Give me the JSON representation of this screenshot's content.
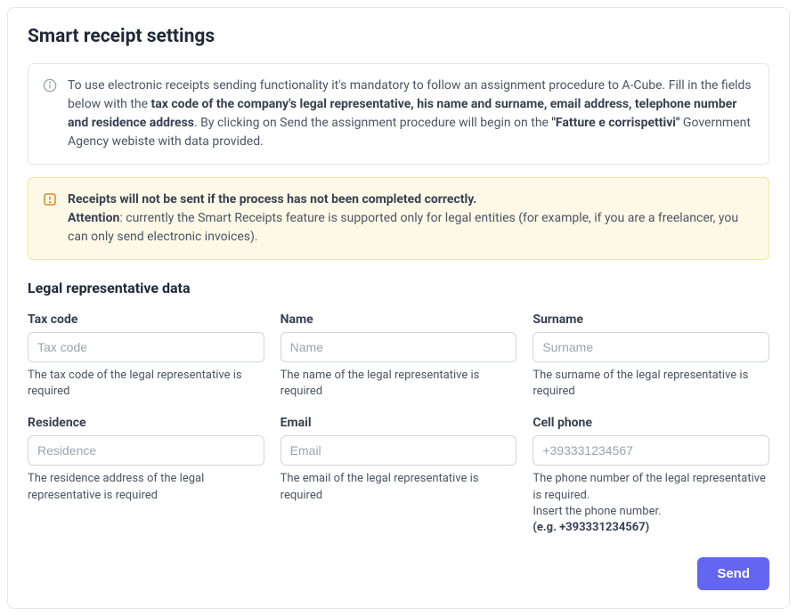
{
  "title": "Smart receipt settings",
  "info_banner": {
    "p1a": "To use electronic receipts sending functionality it's mandatory to follow an assignment procedure to A-Cube. Fill in the fields below with the ",
    "p1b": "tax code of the company's legal representative, his name and surname, email address, telephone number and residence address",
    "p1c": ". By clicking on Send the assignment procedure will begin on the ",
    "p1d": "\"Fatture e corrispettivi\"",
    "p1e": " Government Agency webiste with data provided."
  },
  "warn_banner": {
    "line1": "Receipts will not be sent if the process has not been completed correctly.",
    "line2a": "Attention",
    "line2b": ": currently the Smart Receipts feature is supported only for legal entities (for example, if you are a freelancer, you can only send electronic invoices)."
  },
  "section_title": "Legal representative data",
  "fields": {
    "tax_code": {
      "label": "Tax code",
      "placeholder": "Tax code",
      "helper": "The tax code of the legal representative is required"
    },
    "name": {
      "label": "Name",
      "placeholder": "Name",
      "helper": "The name of the legal representative is required"
    },
    "surname": {
      "label": "Surname",
      "placeholder": "Surname",
      "helper": "The surname of the legal representative is required"
    },
    "residence": {
      "label": "Residence",
      "placeholder": "Residence",
      "helper": "The residence address of the legal representative is required"
    },
    "email": {
      "label": "Email",
      "placeholder": "Email",
      "helper": "The email of the legal representative is required"
    },
    "phone": {
      "label": "Cell phone",
      "placeholder": "+393331234567",
      "helper1": "The phone number of the legal representative is required.",
      "helper2": "Insert the phone number.",
      "helper3": "(e.g. +393331234567)"
    }
  },
  "actions": {
    "send": "Send"
  }
}
